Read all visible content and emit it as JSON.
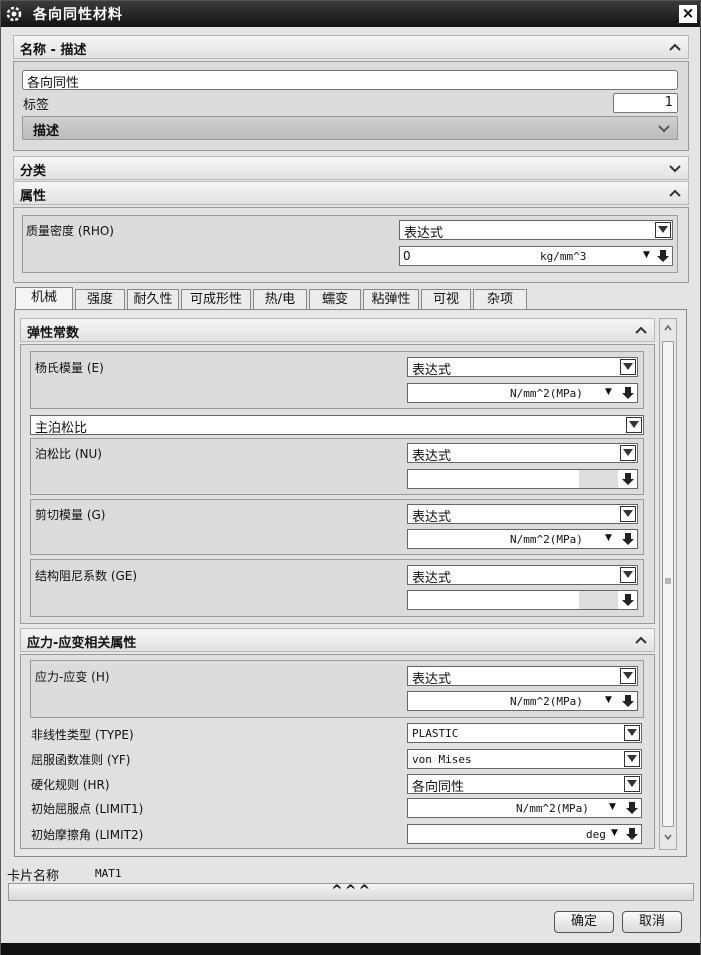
{
  "window": {
    "title": "各向同性材料",
    "close_label": "×"
  },
  "name_section": {
    "header": "名称 - 描述",
    "name_value": "各向同性",
    "label_label": "标签",
    "label_value": "1",
    "description_header": "描述"
  },
  "classification_header": "分类",
  "properties": {
    "header": "属性",
    "density_label": "质量密度 (RHO)",
    "density_type": "表达式",
    "density_value": "0",
    "density_unit": "kg/mm^3"
  },
  "tabs": [
    "机械",
    "强度",
    "耐久性",
    "可成形性",
    "热/电",
    "蠕变",
    "粘弹性",
    "可视",
    "杂项"
  ],
  "elastic": {
    "header": "弹性常数",
    "youngs_label": "杨氏模量 (E)",
    "youngs_type": "表达式",
    "youngs_unit": "N/mm^2(MPa)",
    "poisson_select": "主泊松比",
    "poisson_label": "泊松比 (NU)",
    "poisson_type": "表达式",
    "shear_label": "剪切模量 (G)",
    "shear_type": "表达式",
    "shear_unit": "N/mm^2(MPa)",
    "damping_label": "结构阻尼系数 (GE)",
    "damping_type": "表达式"
  },
  "stress_strain": {
    "header": "应力-应变相关属性",
    "ss_label": "应力-应变 (H)",
    "ss_type": "表达式",
    "ss_unit": "N/mm^2(MPa)",
    "nonlinear_label": "非线性类型 (TYPE)",
    "nonlinear_value": "PLASTIC",
    "yield_fn_label": "屈服函数准则 (YF)",
    "yield_fn_value": "von Mises",
    "hardening_label": "硬化规则 (HR)",
    "hardening_value": "各向同性",
    "init_yield_label": "初始屈服点 (LIMIT1)",
    "init_yield_unit": "N/mm^2(MPa)",
    "init_friction_label": "初始摩擦角 (LIMIT2)",
    "init_friction_unit": "deg"
  },
  "card": {
    "label": "卡片名称",
    "value": "MAT1"
  },
  "expand_label": "^^^",
  "buttons": {
    "ok": "确定",
    "cancel": "取消"
  }
}
